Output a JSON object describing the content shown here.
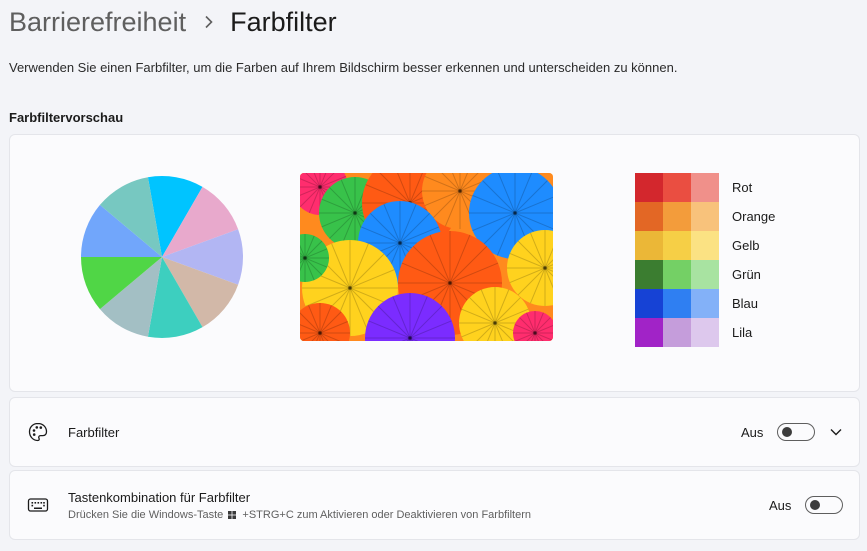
{
  "breadcrumb": {
    "parent": "Barrierefreiheit",
    "separator_icon": "chevron-right-icon",
    "current": "Farbfilter"
  },
  "description": "Verwenden Sie einen Farbfilter, um die Farben auf Ihrem Bildschirm besser erkennen und unterscheiden zu können.",
  "preview": {
    "section_title": "Farbfiltervorschau",
    "pie_colors": [
      "#00c4ff",
      "#e8a9cc",
      "#b2b6f3",
      "#d2b8a8",
      "#3dcfbf",
      "#a3bfc4",
      "#50d646",
      "#71a6fb",
      "#77c8c1"
    ],
    "photo_colors": [
      "#ff5a14",
      "#1e8cff",
      "#ffd21e",
      "#38c24a",
      "#7b2cff",
      "#ff2d6e",
      "#ff8a1e",
      "#00b0d6"
    ],
    "swatches": [
      {
        "label": "Rot",
        "colors": [
          "#d3272d",
          "#ea4e41",
          "#f0908a"
        ]
      },
      {
        "label": "Orange",
        "colors": [
          "#e36725",
          "#f39c3b",
          "#f8c27b"
        ]
      },
      {
        "label": "Gelb",
        "colors": [
          "#ebb737",
          "#f6cf46",
          "#fbe283"
        ]
      },
      {
        "label": "Grün",
        "colors": [
          "#3b7d30",
          "#74d065",
          "#a8e3a1"
        ]
      },
      {
        "label": "Blau",
        "colors": [
          "#1642d5",
          "#2f7ff2",
          "#83b1f8"
        ]
      },
      {
        "label": "Lila",
        "colors": [
          "#a123c7",
          "#c59ddb",
          "#ddc8ed"
        ]
      }
    ]
  },
  "color_filter": {
    "icon": "palette-icon",
    "label": "Farbfilter",
    "state": "Aus",
    "on": false,
    "expand_icon": "chevron-down-icon"
  },
  "shortcut": {
    "icon": "keyboard-icon",
    "title": "Tastenkombination für Farbfilter",
    "subtitle_before": "Drücken Sie die Windows-Taste",
    "subtitle_icon": "windows-logo-icon",
    "subtitle_after": "+STRG+C zum Aktivieren oder Deaktivieren von Farbfiltern",
    "state": "Aus",
    "on": false
  }
}
